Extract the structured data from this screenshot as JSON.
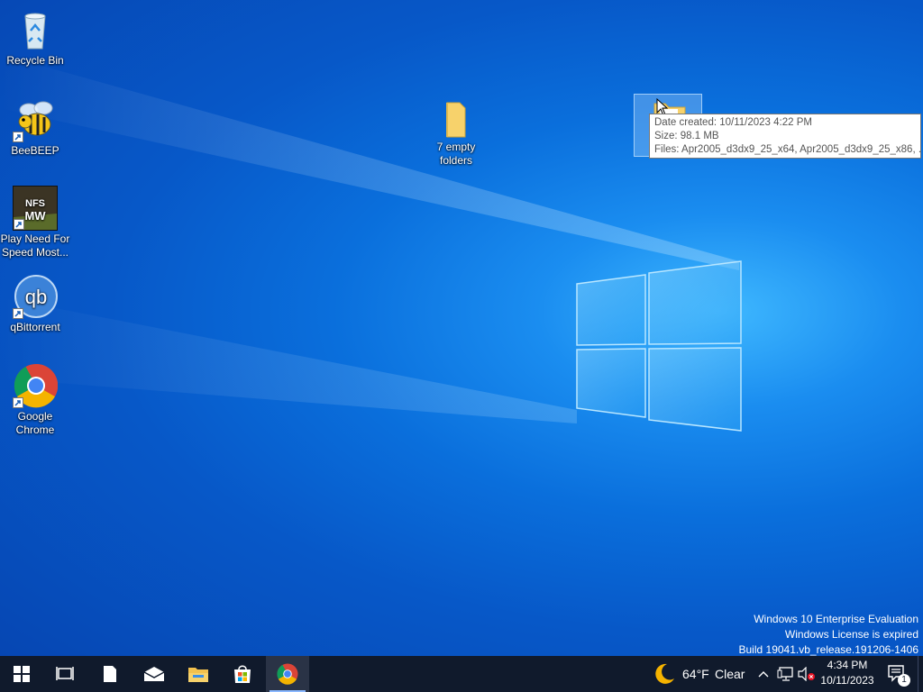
{
  "desktop": {
    "icons": [
      {
        "label": "Recycle Bin",
        "icon": "recycle-bin-icon"
      },
      {
        "label": "BeeBEEP",
        "icon": "beebeep-icon"
      },
      {
        "label": "Play Need For Speed Most...",
        "icon": "nfs-mw-icon",
        "art_text": "NFS MW"
      },
      {
        "label": "qBittorrent",
        "icon": "qbittorrent-icon",
        "art_text": "qb"
      },
      {
        "label": "Google Chrome",
        "icon": "chrome-icon"
      },
      {
        "label": "7 empty folders",
        "icon": "folder-icon"
      }
    ],
    "tooltip": {
      "date_created": "Date created: 10/11/2023 4:22 PM",
      "size": "Size: 98.1 MB",
      "files": "Files: Apr2005_d3dx9_25_x64, Apr2005_d3dx9_25_x86, ..."
    },
    "watermark": {
      "line1": "Windows 10 Enterprise Evaluation",
      "line2": "Windows License is expired",
      "line3": "Build 19041.vb_release.191206-1406"
    }
  },
  "taskbar": {
    "buttons": [
      "start-icon",
      "task-view-icon",
      "notepad-icon",
      "mail-icon",
      "file-explorer-icon",
      "store-icon",
      "chrome-icon"
    ],
    "weather": {
      "temp": "64°F",
      "condition": "Clear"
    },
    "clock": {
      "time": "4:34 PM",
      "date": "10/11/2023"
    },
    "notifications_count": "1"
  },
  "colors": {
    "taskbar": "#101a2c",
    "desktop_accent": "#0a6fdc"
  }
}
